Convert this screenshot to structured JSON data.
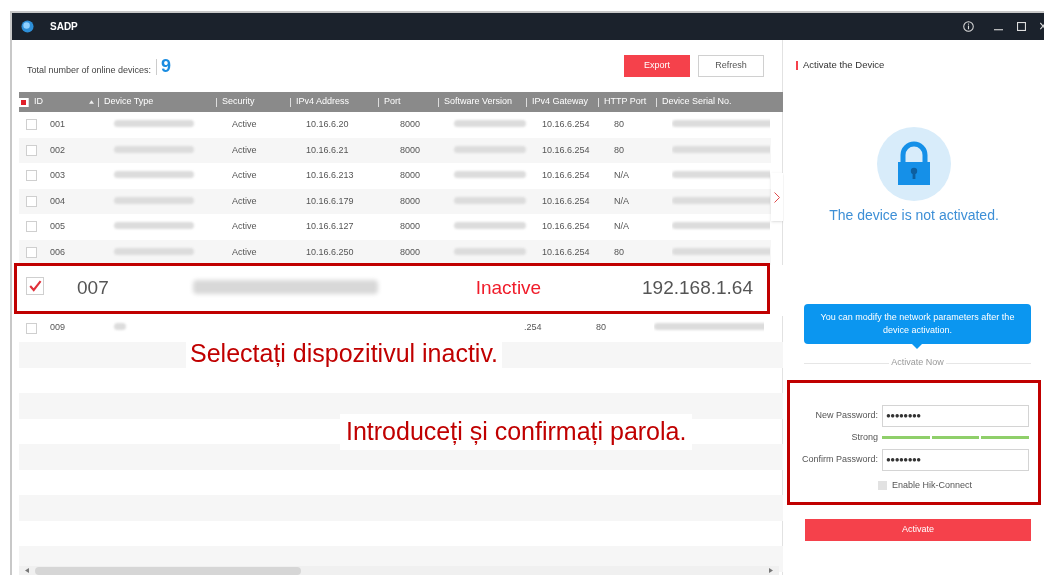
{
  "window": {
    "title": "SADP"
  },
  "summary": {
    "label": "Total number of online devices:",
    "count": "9"
  },
  "toolbar": {
    "buttons": [
      {
        "label": "Export",
        "kind": "primary"
      },
      {
        "label": "Refresh",
        "kind": "secondary"
      }
    ]
  },
  "table": {
    "select_all": {
      "indeterminate": true
    },
    "columns": [
      {
        "label": "ID",
        "sorted": true
      },
      {
        "label": "Device Type",
        "sorted": false
      },
      {
        "label": "Security",
        "sorted": false
      },
      {
        "label": "IPv4 Address",
        "sorted": false
      },
      {
        "label": "Port",
        "sorted": false
      },
      {
        "label": "Software Version",
        "sorted": false
      },
      {
        "label": "IPv4 Gateway",
        "sorted": false
      },
      {
        "label": "HTTP Port",
        "sorted": false
      },
      {
        "label": "Device Serial No.",
        "sorted": false
      }
    ],
    "rows": [
      {
        "id": "001",
        "security": "Active",
        "ipv4": "10.16.6.20",
        "port": "8000",
        "gateway": "10.16.6.254",
        "http_port": "80",
        "checked": false
      },
      {
        "id": "002",
        "security": "Active",
        "ipv4": "10.16.6.21",
        "port": "8000",
        "gateway": "10.16.6.254",
        "http_port": "80",
        "checked": false
      },
      {
        "id": "003",
        "security": "Active",
        "ipv4": "10.16.6.213",
        "port": "8000",
        "gateway": "10.16.6.254",
        "http_port": "N/A",
        "checked": false
      },
      {
        "id": "004",
        "security": "Active",
        "ipv4": "10.16.6.179",
        "port": "8000",
        "gateway": "10.16.6.254",
        "http_port": "N/A",
        "checked": false
      },
      {
        "id": "005",
        "security": "Active",
        "ipv4": "10.16.6.127",
        "port": "8000",
        "gateway": "10.16.6.254",
        "http_port": "N/A",
        "checked": false
      },
      {
        "id": "006",
        "security": "Active",
        "ipv4": "10.16.6.250",
        "port": "8000",
        "gateway": "10.16.6.254",
        "http_port": "80",
        "checked": false
      }
    ],
    "last_row": {
      "id": "009",
      "gateway": ".254",
      "http_port": "80",
      "checked": false
    }
  },
  "callout_row": {
    "id": "007",
    "security": "Inactive",
    "ipv4": "192.168.1.64",
    "checked": true
  },
  "annotations": [
    "Selectați dispozitivul inactiv.",
    "Introduceți și confirmați parola."
  ],
  "panel": {
    "title": "Activate the Device",
    "status": "The device is not activated.",
    "tooltip": "You can modify the network parameters after the device activation.",
    "divider_label": "Activate Now",
    "fields": [
      {
        "label": "New Password:",
        "value": "●●●●●●●●"
      },
      {
        "label": "Confirm Password:",
        "value": "●●●●●●●●"
      }
    ],
    "strength": {
      "label": "Strong",
      "level": 1
    },
    "hik_connect": {
      "label": "Enable Hik-Connect",
      "checked": false
    },
    "activate_button": "Activate"
  }
}
